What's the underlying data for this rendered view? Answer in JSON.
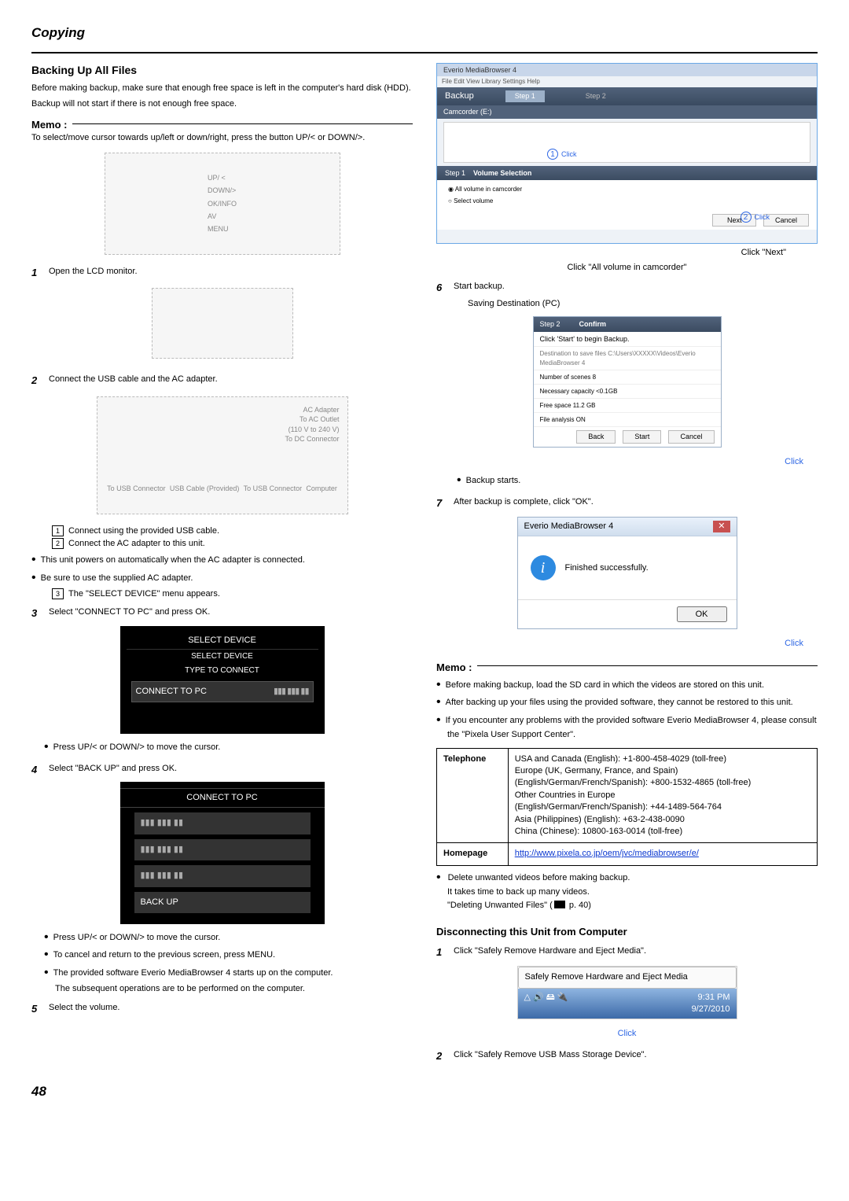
{
  "page": {
    "header": "Copying",
    "number": "48"
  },
  "left": {
    "title": "Backing Up All Files",
    "intro1": "Before making backup, make sure that enough free space is left in the computer's hard disk (HDD).",
    "intro2": "Backup will not start if there is not enough free space.",
    "memo_label": "Memo :",
    "memo_text": "To select/move cursor towards up/left or down/right, press the button UP/< or DOWN/>.",
    "btnlabels": {
      "up": "UP/ <",
      "down": "DOWN/>",
      "okinfo": "OK/INFO",
      "av": "AV",
      "menu": "MENU"
    },
    "step1": "Open the LCD monitor.",
    "step2": "Connect the USB cable and the AC adapter.",
    "conn_labels": {
      "ac": "AC Adapter",
      "outlet": "To AC Outlet",
      "volt": "(110 V to 240 V)",
      "dc": "To DC Connector",
      "usb1": "To USB Connector",
      "cable": "USB Cable (Provided)",
      "usb2": "To USB Connector",
      "computer": "Computer"
    },
    "conn_steps": {
      "a": "Connect using the provided USB cable.",
      "b": "Connect the AC adapter to this unit."
    },
    "bullets_after_conn": [
      "This unit powers on automatically when the AC adapter is connected.",
      "Be sure to use the supplied AC adapter."
    ],
    "conn_step_c": "The \"SELECT DEVICE\" menu appears.",
    "step3": "Select \"CONNECT TO PC\" and press OK.",
    "lcd1": {
      "header": "SELECT DEVICE",
      "sub1": "SELECT DEVICE",
      "sub2": "TYPE TO CONNECT",
      "row": "CONNECT TO PC"
    },
    "step3_bullet": "Press UP/< or DOWN/> to move the cursor.",
    "step4": "Select \"BACK UP\" and press OK.",
    "lcd2": {
      "header": "CONNECT TO PC",
      "row": "BACK UP"
    },
    "step4_bullets": [
      "Press UP/< or DOWN/> to move the cursor.",
      "To cancel and return to the previous screen, press MENU.",
      "The provided software Everio MediaBrowser 4 starts up on the computer.",
      "The subsequent operations are to be performed on the computer."
    ],
    "step5": "Select the volume."
  },
  "right": {
    "big_shot": {
      "menus": "File Edit View Library Settings Help",
      "backup": "Backup",
      "step1": "Step 1",
      "step2": "Step 2",
      "camcorder": "Camcorder (E:)",
      "click1": "Click",
      "vol_sel_step": "Step 1",
      "vol_sel": "Volume Selection",
      "opt_all": "All volume in camcorder",
      "opt_sel": "Select volume",
      "btn_next": "Next",
      "btn_cancel": "Cancel",
      "click2": "Click",
      "next_cap": "Click \"Next\"",
      "all_cap": "Click \"All volume in camcorder\""
    },
    "step6": "Start backup.",
    "saving_label": "Saving Destination (PC)",
    "grey_gal": {
      "h1": "Step 2",
      "h2": "Confirm",
      "l1": "Click 'Start' to begin Backup.",
      "l2": "Destination to save files C:\\Users\\XXXXX\\Videos\\Everio MediaBrowser 4",
      "l3": "Number of scenes 8",
      "l4": "Necessary capacity <0.1GB",
      "l5": "Free space 11.2 GB",
      "l6": "File analysis ON",
      "b_back": "Back",
      "b_start": "Start",
      "b_cancel": "Cancel",
      "click": "Click"
    },
    "step6_bullet": "Backup starts.",
    "step7": "After backup is complete, click \"OK\".",
    "dialog": {
      "title": "Everio MediaBrowser 4",
      "msg": "Finished successfully.",
      "ok": "OK",
      "click": "Click"
    },
    "memo_label": "Memo :",
    "memo_bullets": [
      "Before making backup, load the SD card in which the videos are stored on this unit.",
      "After backing up your files using the provided software, they cannot be restored to this unit.",
      "If you encounter any problems with the provided software Everio MediaBrowser 4, please consult the \"Pixela User Support Center\"."
    ],
    "contact": {
      "tel_label": "Telephone",
      "tel_lines": "USA and Canada (English): +1-800-458-4029 (toll-free)\nEurope (UK, Germany, France, and Spain)\n(English/German/French/Spanish): +800-1532-4865 (toll-free)\nOther Countries in Europe\n(English/German/French/Spanish): +44-1489-564-764\nAsia (Philippines) (English): +63-2-438-0090\nChina (Chinese): 10800-163-0014 (toll-free)",
      "home_label": "Homepage",
      "home_link": "http://www.pixela.co.jp/oem/jvc/mediabrowser/e/"
    },
    "after_table_bullets_1": "Delete unwanted videos before making backup.",
    "after_table_sub": "It takes time to back up many videos.",
    "ref": "\"Deleting Unwanted Files\" (",
    "ref_page": " p. 40)",
    "disc_title": "Disconnecting this Unit from Computer",
    "disc_step1": "Click \"Safely Remove Hardware and Eject Media\".",
    "tray": {
      "balloon": "Safely Remove Hardware and Eject Media",
      "time": "9:31 PM",
      "date": "9/27/2010",
      "click": "Click"
    },
    "disc_step2": "Click \"Safely Remove USB Mass Storage Device\"."
  }
}
